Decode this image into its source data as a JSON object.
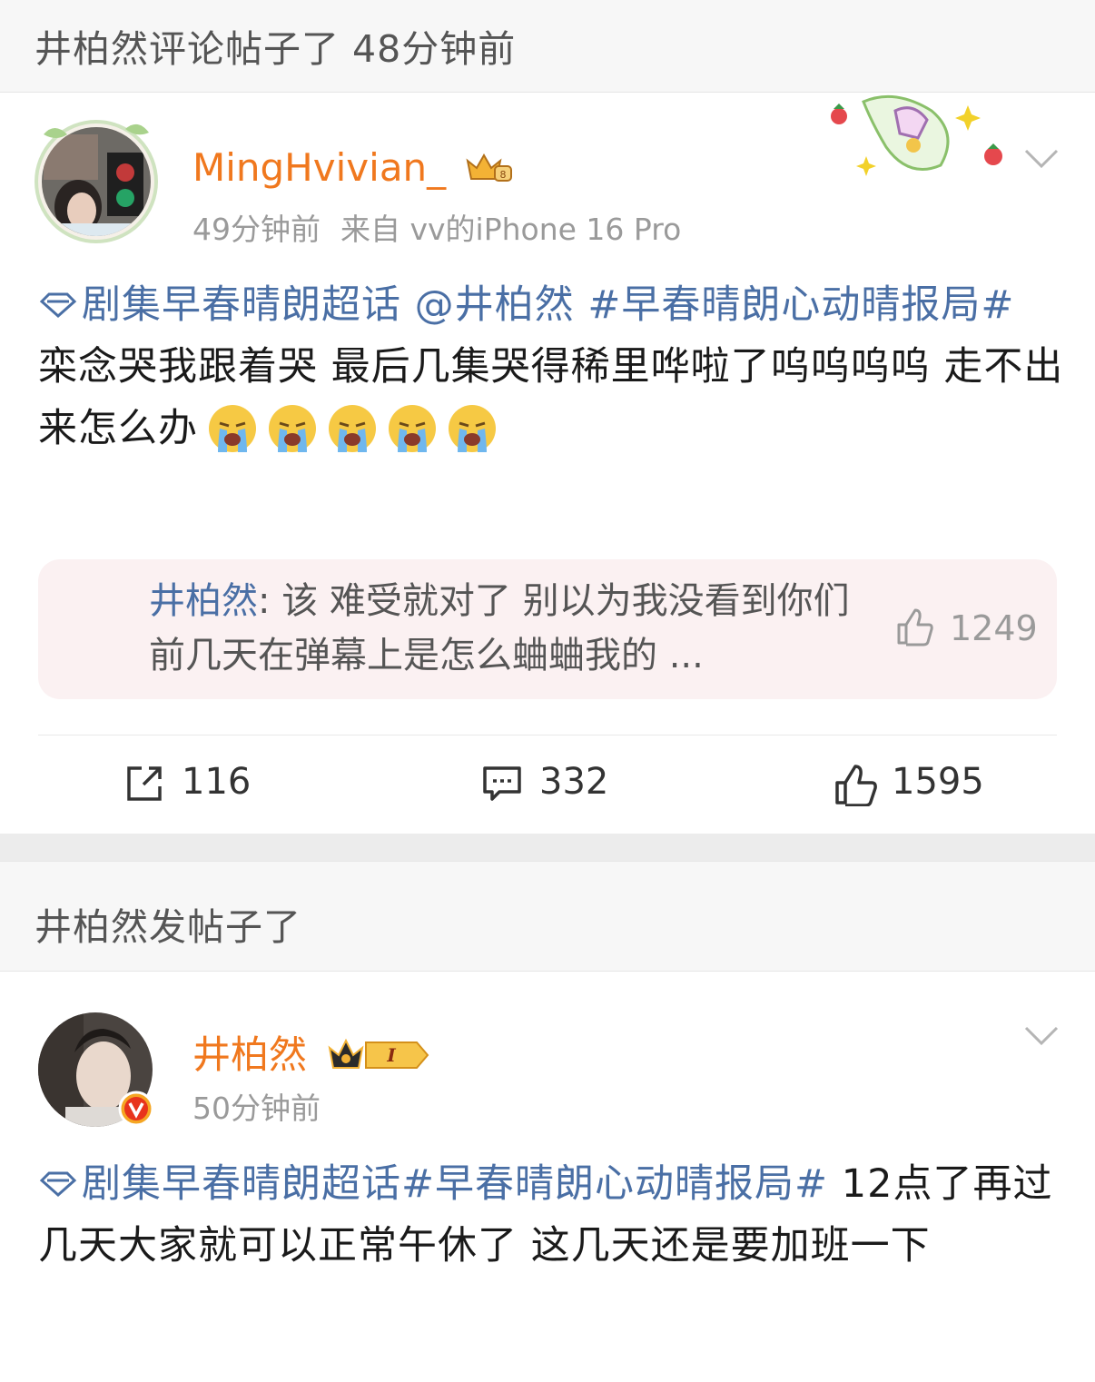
{
  "feed": {
    "item1": {
      "header": "井柏然评论帖子了 48分钟前",
      "username": "MingHvivian_",
      "time": "49分钟前",
      "source": "来自 vv的iPhone 16 Pro",
      "text": {
        "tag": "剧集早春晴朗超话",
        "mention": " @井柏然",
        "hashtag": " #早春晴朗心动晴报局#",
        "body": "栾念哭我跟着哭 最后几集哭得稀里哗啦了呜呜呜呜 走不出来怎么办"
      },
      "quote": {
        "name": "井柏然",
        "text": ": 该 难受就对了 别以为我没看到你们前几天在弹幕上是怎么蛐蛐我的 ...",
        "likes": "1249"
      },
      "actions": {
        "reposts": "116",
        "comments": "332",
        "likes": "1595"
      }
    },
    "item2": {
      "header": "井柏然发帖子了",
      "username": "井柏然",
      "time": "50分钟前",
      "text": {
        "tag": "剧集早春晴朗超话",
        "hashtag": "#早春晴朗心动晴报局#",
        "body": " 12点了再过几天大家就可以正常午休了 这几天还是要加班一下"
      }
    }
  },
  "colors": {
    "username": "#f0781e",
    "link": "#4a6fa5",
    "meta": "#9a9a9a",
    "quote_bg": "#fbf1f2"
  },
  "icons": [
    "topic-diamond-icon",
    "crying-emoji-icon",
    "repost-icon",
    "comment-icon",
    "thumbs-up-icon",
    "chevron-down-icon",
    "verified-v-icon",
    "crown-badge-icon"
  ]
}
